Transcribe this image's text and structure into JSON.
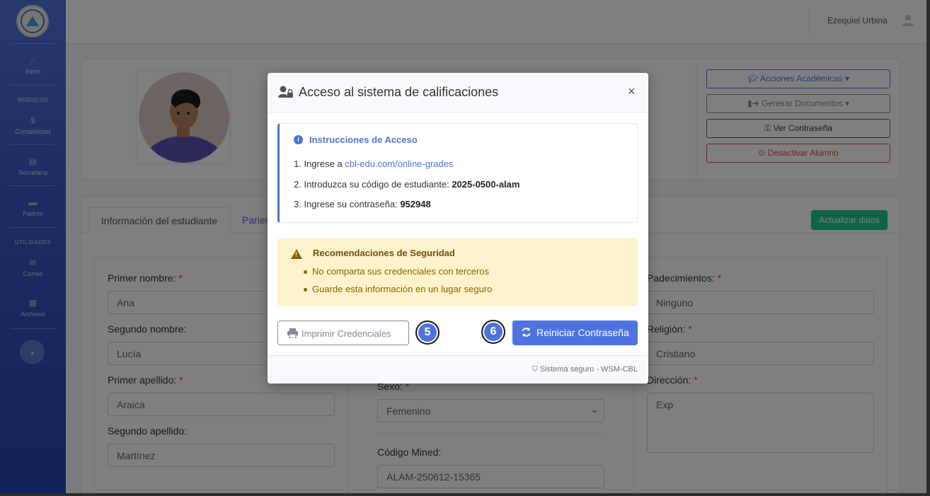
{
  "sidebar": {
    "items": [
      {
        "label": "Inicio",
        "icon": "home-icon"
      },
      {
        "label": "Contabilidad",
        "icon": "dollar-icon"
      },
      {
        "label": "Secretaría",
        "icon": "book-icon"
      },
      {
        "label": "Padrón",
        "icon": "folder-icon"
      },
      {
        "label": "Correo",
        "icon": "envelope-icon"
      },
      {
        "label": "Archivos",
        "icon": "archive-icon"
      }
    ],
    "headings": {
      "modulos": "MODULOS",
      "utilidades": "UTILIDADES"
    },
    "toggle": "›"
  },
  "topbar": {
    "user_name": "Ezequiel Urbina"
  },
  "profile": {
    "actions": {
      "academic": "Acciones Académicas",
      "documents": "Generar Documentos",
      "password": "Ver Contraseña",
      "deactivate": "Desactivar Alumno"
    }
  },
  "tabs": {
    "info": "Información del estudiante",
    "relatives": "Parien"
  },
  "update_button": "Actualizar datos",
  "form": {
    "first_name": {
      "label": "Primer nombre:",
      "value": "Ana"
    },
    "second_name": {
      "label": "Segundo nombre:",
      "value": "Lucía"
    },
    "first_surname": {
      "label": "Primer apellido:",
      "value": "Araica"
    },
    "second_surname": {
      "label": "Segundo apellido:",
      "value": "Martínez"
    },
    "sex": {
      "label": "Sexo:",
      "value": "Femenino"
    },
    "mined_code": {
      "label": "Código Mined:",
      "value": "ALAM-250612-15365"
    },
    "conditions": {
      "label": "Padecimientos:",
      "value": "Ninguno"
    },
    "religion": {
      "label": "Religión:",
      "value": "Cristiano"
    },
    "address": {
      "label": "Dirección:",
      "value": "Exp"
    },
    "required_mark": "*"
  },
  "modal": {
    "title": "Acceso al sistema de calificaciones",
    "close": "×",
    "instructions": {
      "title": "Instrucciones de Acceso",
      "step1_prefix": "1. Ingrese a ",
      "step1_link": "cbl-edu.com/online-grades",
      "step2_prefix": "2. Introduzca su código de estudiante: ",
      "step2_value": "2025-0500-alam",
      "step3_prefix": "3. Ingrese su contraseña: ",
      "step3_value": "952948"
    },
    "security": {
      "title": "Recomendaciones de Seguridad",
      "items": [
        "No comparta sus credenciales con terceros",
        "Guarde esta información en un lugar seguro"
      ]
    },
    "print_button": "Imprimir Credenciales",
    "reset_button": "Reiniciar Contraseña",
    "marker_5": "5",
    "marker_6": "6",
    "footer": "Sistema seguro - WSM-CBL"
  },
  "colors": {
    "primary": "#4e73df",
    "success": "#1cc88a",
    "danger": "#e74a3b",
    "warning_bg": "#fff3cd"
  }
}
